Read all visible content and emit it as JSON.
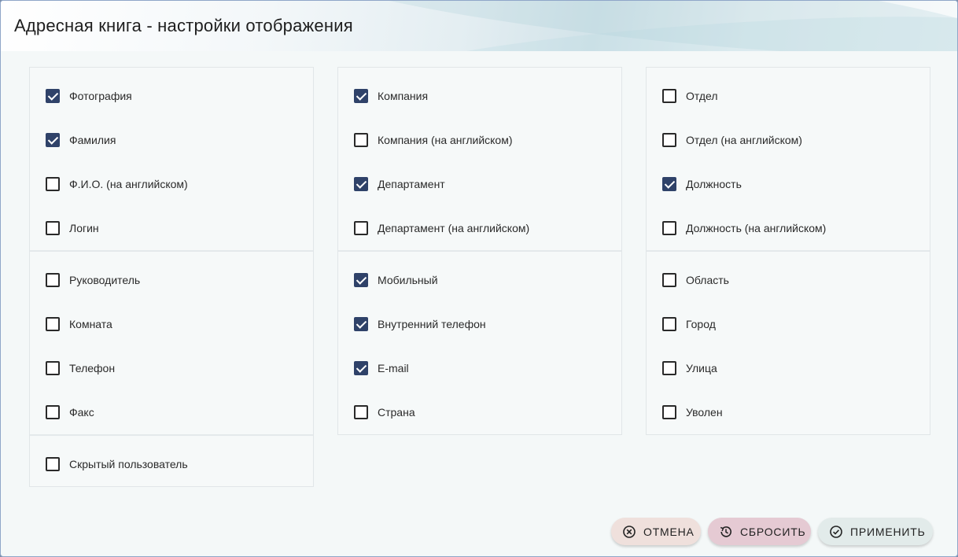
{
  "title": "Адресная книга - настройки отображения",
  "columns": [
    {
      "groups": [
        [
          {
            "label": "Фотография",
            "checked": true
          },
          {
            "label": "Фамилия",
            "checked": true
          },
          {
            "label": "Ф.И.О. (на английском)",
            "checked": false
          },
          {
            "label": "Логин",
            "checked": false
          }
        ],
        [
          {
            "label": "Руководитель",
            "checked": false
          },
          {
            "label": "Комната",
            "checked": false
          },
          {
            "label": "Телефон",
            "checked": false
          },
          {
            "label": "Факс",
            "checked": false
          }
        ],
        [
          {
            "label": "Скрытый пользователь",
            "checked": false
          }
        ]
      ]
    },
    {
      "groups": [
        [
          {
            "label": "Компания",
            "checked": true
          },
          {
            "label": "Компания (на английском)",
            "checked": false
          },
          {
            "label": "Департамент",
            "checked": true
          },
          {
            "label": "Департамент (на английском)",
            "checked": false
          }
        ],
        [
          {
            "label": "Мобильный",
            "checked": true
          },
          {
            "label": "Внутренний телефон",
            "checked": true
          },
          {
            "label": "E-mail",
            "checked": true
          },
          {
            "label": "Страна",
            "checked": false
          }
        ]
      ]
    },
    {
      "groups": [
        [
          {
            "label": "Отдел",
            "checked": false
          },
          {
            "label": "Отдел (на английском)",
            "checked": false
          },
          {
            "label": "Должность",
            "checked": true
          },
          {
            "label": "Должность (на английском)",
            "checked": false
          }
        ],
        [
          {
            "label": "Область",
            "checked": false
          },
          {
            "label": "Город",
            "checked": false
          },
          {
            "label": "Улица",
            "checked": false
          },
          {
            "label": "Уволен",
            "checked": false
          }
        ]
      ]
    }
  ],
  "buttons": {
    "cancel": {
      "label": "ОТМЕНА",
      "icon": "cancel-circle-icon"
    },
    "reset": {
      "label": "СБРОСИТЬ",
      "icon": "history-restore-icon"
    },
    "apply": {
      "label": "ПРИМЕНИТЬ",
      "icon": "check-circle-icon"
    }
  },
  "colors": {
    "checkbox_checked": "#2f4269",
    "cancel_button": "#efe0dc",
    "reset_button": "#e5cad3",
    "apply_button": "#e2ebea"
  }
}
